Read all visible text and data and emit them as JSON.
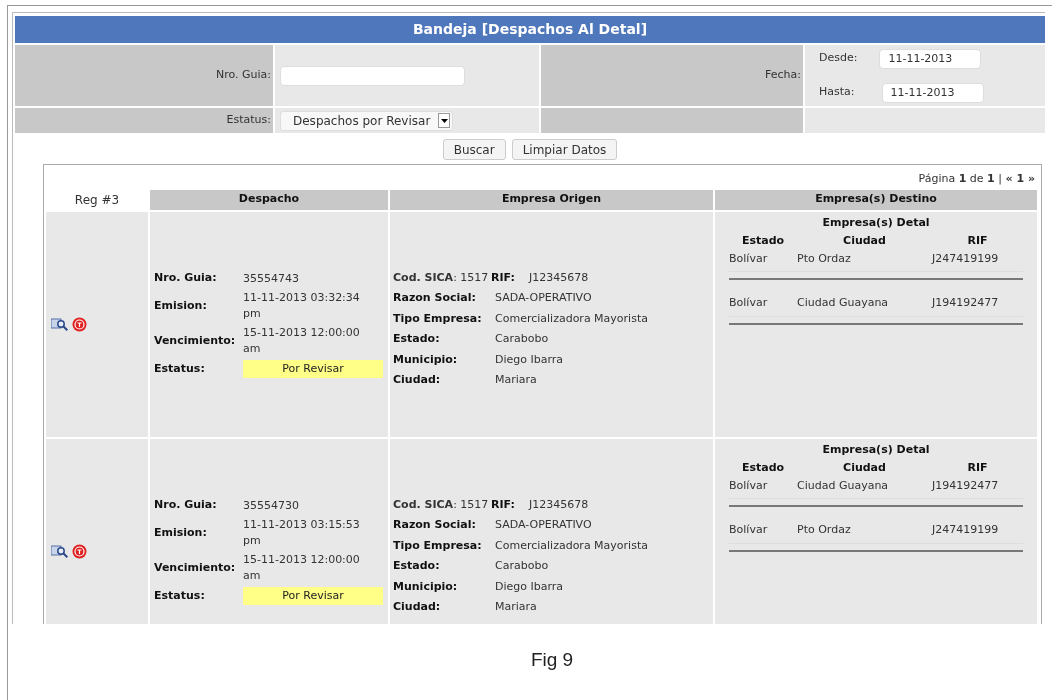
{
  "title": "Bandeja [Despachos Al Detal]",
  "filters": {
    "nro_guia": {
      "label": "Nro. Guia:"
    },
    "fecha": {
      "label": "Fecha:",
      "desde": {
        "label": "Desde:",
        "value": "11-11-2013"
      },
      "hasta": {
        "label": "Hasta:",
        "value": "11-11-2013"
      }
    },
    "estatus": {
      "label": "Estatus:",
      "value": "Despachos por Revisar"
    }
  },
  "buttons": [
    "Buscar",
    "Limpiar Datos"
  ],
  "pagination": "Página **1** de **1** | **« 1 »**",
  "table": {
    "columns": [
      "Reg #3",
      "Despacho",
      "Empresa Origen",
      "Empresa(s) Destino"
    ],
    "rows": [
      {
        "despacho": [
          {
            "label": "Nro. Guia:",
            "value": "35554743"
          },
          {
            "label": "Emision:",
            "value": "11-11-2013 03:32:34 pm"
          },
          {
            "label": "Vencimiento:",
            "value": "15-11-2013 12:00:00 am"
          }
        ],
        "estatus": {
          "label": "Estatus:",
          "value": "Por Revisar"
        },
        "origen": {
          "cod_sica": "**Cod. SICA**: 1517",
          "rif": {
            "label": "RIF:",
            "value": "J12345678"
          },
          "fields": [
            {
              "label": "Razon Social:",
              "value": "SADA-OPERATIVO"
            },
            {
              "label": "Tipo Empresa:",
              "value": "Comercializadora Mayorista"
            },
            {
              "label": "Estado:",
              "value": "Carabobo"
            },
            {
              "label": "Municipio:",
              "value": "Diego Ibarra"
            },
            {
              "label": "Ciudad:",
              "value": "Mariara"
            }
          ]
        },
        "destino": {
          "title": "Empresa(s) Detal",
          "columns": [
            "Estado",
            "Ciudad",
            "RIF"
          ],
          "rows": [
            [
              "Bolívar",
              "Pto Ordaz",
              "J247419199"
            ],
            [
              "Bolívar",
              "Ciudad Guayana",
              "J194192477"
            ]
          ]
        }
      },
      {
        "despacho": [
          {
            "label": "Nro. Guia:",
            "value": "35554730"
          },
          {
            "label": "Emision:",
            "value": "11-11-2013 03:15:53 pm"
          },
          {
            "label": "Vencimiento:",
            "value": "15-11-2013 12:00:00 am"
          }
        ],
        "estatus": {
          "label": "Estatus:",
          "value": "Por Revisar"
        },
        "origen": {
          "cod_sica": "**Cod. SICA**: 1517",
          "rif": {
            "label": "RIF:",
            "value": "J12345678"
          },
          "fields": [
            {
              "label": "Razon Social:",
              "value": "SADA-OPERATIVO"
            },
            {
              "label": "Tipo Empresa:",
              "value": "Comercializadora Mayorista"
            },
            {
              "label": "Estado:",
              "value": "Carabobo"
            },
            {
              "label": "Municipio:",
              "value": "Diego Ibarra"
            },
            {
              "label": "Ciudad:",
              "value": "Mariara"
            }
          ]
        },
        "destino": {
          "title": "Empresa(s) Detal",
          "columns": [
            "Estado",
            "Ciudad",
            "RIF"
          ],
          "rows": [
            [
              "Bolívar",
              "Ciudad Guayana",
              "J194192477"
            ],
            [
              "Bolívar",
              "Pto Ordaz",
              "J247419199"
            ]
          ]
        }
      }
    ]
  },
  "caption": "Fig 9"
}
